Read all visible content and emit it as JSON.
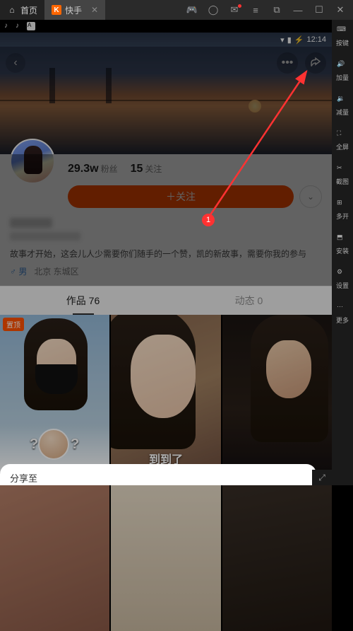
{
  "titlebar": {
    "home_tab": "首页",
    "app_tab": "快手"
  },
  "sidebar": {
    "keyboard": "按键",
    "vol_up": "加量",
    "vol_down": "减量",
    "fullscreen": "全屏",
    "screenshot": "截图",
    "multi": "多开",
    "install": "安装",
    "settings": "设置",
    "more": "更多"
  },
  "status": {
    "time": "12:14"
  },
  "profile": {
    "fans_count": "29.3w",
    "fans_label": "粉丝",
    "follow_count": "15",
    "follow_label": "关注",
    "follow_btn": "＋关注",
    "bio": "故事才开始，这会儿人少需要你们随手的一个赞，凯的新故事，需要你我的参与",
    "gender": "♂ 男",
    "location": "北京 东城区"
  },
  "tabs": {
    "works": "作品 76",
    "moments": "动态 0"
  },
  "videos": {
    "pin": "置顶",
    "caption2": "到到了"
  },
  "sheet": {
    "title": "分享至"
  },
  "annotation": {
    "num": "1"
  }
}
